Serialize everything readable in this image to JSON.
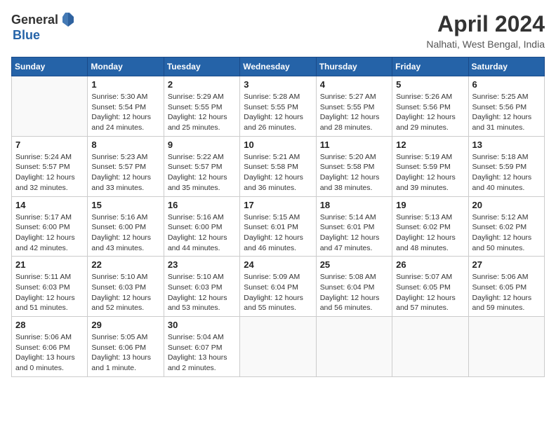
{
  "header": {
    "logo_general": "General",
    "logo_blue": "Blue",
    "title": "April 2024",
    "location": "Nalhati, West Bengal, India"
  },
  "weekdays": [
    "Sunday",
    "Monday",
    "Tuesday",
    "Wednesday",
    "Thursday",
    "Friday",
    "Saturday"
  ],
  "weeks": [
    [
      {
        "day": "",
        "info": ""
      },
      {
        "day": "1",
        "info": "Sunrise: 5:30 AM\nSunset: 5:54 PM\nDaylight: 12 hours\nand 24 minutes."
      },
      {
        "day": "2",
        "info": "Sunrise: 5:29 AM\nSunset: 5:55 PM\nDaylight: 12 hours\nand 25 minutes."
      },
      {
        "day": "3",
        "info": "Sunrise: 5:28 AM\nSunset: 5:55 PM\nDaylight: 12 hours\nand 26 minutes."
      },
      {
        "day": "4",
        "info": "Sunrise: 5:27 AM\nSunset: 5:55 PM\nDaylight: 12 hours\nand 28 minutes."
      },
      {
        "day": "5",
        "info": "Sunrise: 5:26 AM\nSunset: 5:56 PM\nDaylight: 12 hours\nand 29 minutes."
      },
      {
        "day": "6",
        "info": "Sunrise: 5:25 AM\nSunset: 5:56 PM\nDaylight: 12 hours\nand 31 minutes."
      }
    ],
    [
      {
        "day": "7",
        "info": "Sunrise: 5:24 AM\nSunset: 5:57 PM\nDaylight: 12 hours\nand 32 minutes."
      },
      {
        "day": "8",
        "info": "Sunrise: 5:23 AM\nSunset: 5:57 PM\nDaylight: 12 hours\nand 33 minutes."
      },
      {
        "day": "9",
        "info": "Sunrise: 5:22 AM\nSunset: 5:57 PM\nDaylight: 12 hours\nand 35 minutes."
      },
      {
        "day": "10",
        "info": "Sunrise: 5:21 AM\nSunset: 5:58 PM\nDaylight: 12 hours\nand 36 minutes."
      },
      {
        "day": "11",
        "info": "Sunrise: 5:20 AM\nSunset: 5:58 PM\nDaylight: 12 hours\nand 38 minutes."
      },
      {
        "day": "12",
        "info": "Sunrise: 5:19 AM\nSunset: 5:59 PM\nDaylight: 12 hours\nand 39 minutes."
      },
      {
        "day": "13",
        "info": "Sunrise: 5:18 AM\nSunset: 5:59 PM\nDaylight: 12 hours\nand 40 minutes."
      }
    ],
    [
      {
        "day": "14",
        "info": "Sunrise: 5:17 AM\nSunset: 6:00 PM\nDaylight: 12 hours\nand 42 minutes."
      },
      {
        "day": "15",
        "info": "Sunrise: 5:16 AM\nSunset: 6:00 PM\nDaylight: 12 hours\nand 43 minutes."
      },
      {
        "day": "16",
        "info": "Sunrise: 5:16 AM\nSunset: 6:00 PM\nDaylight: 12 hours\nand 44 minutes."
      },
      {
        "day": "17",
        "info": "Sunrise: 5:15 AM\nSunset: 6:01 PM\nDaylight: 12 hours\nand 46 minutes."
      },
      {
        "day": "18",
        "info": "Sunrise: 5:14 AM\nSunset: 6:01 PM\nDaylight: 12 hours\nand 47 minutes."
      },
      {
        "day": "19",
        "info": "Sunrise: 5:13 AM\nSunset: 6:02 PM\nDaylight: 12 hours\nand 48 minutes."
      },
      {
        "day": "20",
        "info": "Sunrise: 5:12 AM\nSunset: 6:02 PM\nDaylight: 12 hours\nand 50 minutes."
      }
    ],
    [
      {
        "day": "21",
        "info": "Sunrise: 5:11 AM\nSunset: 6:03 PM\nDaylight: 12 hours\nand 51 minutes."
      },
      {
        "day": "22",
        "info": "Sunrise: 5:10 AM\nSunset: 6:03 PM\nDaylight: 12 hours\nand 52 minutes."
      },
      {
        "day": "23",
        "info": "Sunrise: 5:10 AM\nSunset: 6:03 PM\nDaylight: 12 hours\nand 53 minutes."
      },
      {
        "day": "24",
        "info": "Sunrise: 5:09 AM\nSunset: 6:04 PM\nDaylight: 12 hours\nand 55 minutes."
      },
      {
        "day": "25",
        "info": "Sunrise: 5:08 AM\nSunset: 6:04 PM\nDaylight: 12 hours\nand 56 minutes."
      },
      {
        "day": "26",
        "info": "Sunrise: 5:07 AM\nSunset: 6:05 PM\nDaylight: 12 hours\nand 57 minutes."
      },
      {
        "day": "27",
        "info": "Sunrise: 5:06 AM\nSunset: 6:05 PM\nDaylight: 12 hours\nand 59 minutes."
      }
    ],
    [
      {
        "day": "28",
        "info": "Sunrise: 5:06 AM\nSunset: 6:06 PM\nDaylight: 13 hours\nand 0 minutes."
      },
      {
        "day": "29",
        "info": "Sunrise: 5:05 AM\nSunset: 6:06 PM\nDaylight: 13 hours\nand 1 minute."
      },
      {
        "day": "30",
        "info": "Sunrise: 5:04 AM\nSunset: 6:07 PM\nDaylight: 13 hours\nand 2 minutes."
      },
      {
        "day": "",
        "info": ""
      },
      {
        "day": "",
        "info": ""
      },
      {
        "day": "",
        "info": ""
      },
      {
        "day": "",
        "info": ""
      }
    ]
  ]
}
